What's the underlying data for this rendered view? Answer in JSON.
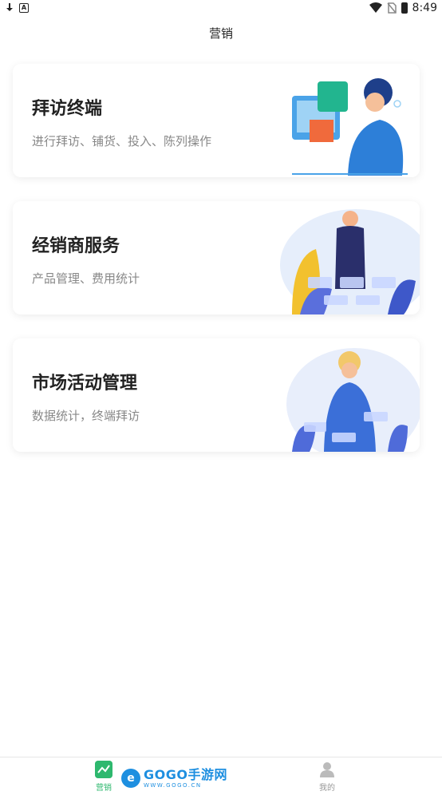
{
  "status_bar": {
    "time": "8:49"
  },
  "header": {
    "title": "营销"
  },
  "cards": [
    {
      "title": "拜访终端",
      "desc": "进行拜访、铺货、投入、陈列操作"
    },
    {
      "title": "经销商服务",
      "desc": "产品管理、费用统计"
    },
    {
      "title": "市场活动管理",
      "desc": "数据统计，终端拜访"
    }
  ],
  "tabbar": {
    "tabs": [
      {
        "label": "营销"
      },
      {
        "label": "我的"
      }
    ]
  },
  "watermark": {
    "main": "GOGO手游网",
    "sub": "WWW.GOGO.CN"
  },
  "colors": {
    "accent": "#2eb86e",
    "text_primary": "#222222",
    "text_secondary": "#888888",
    "watermark": "#1e8fe0"
  }
}
